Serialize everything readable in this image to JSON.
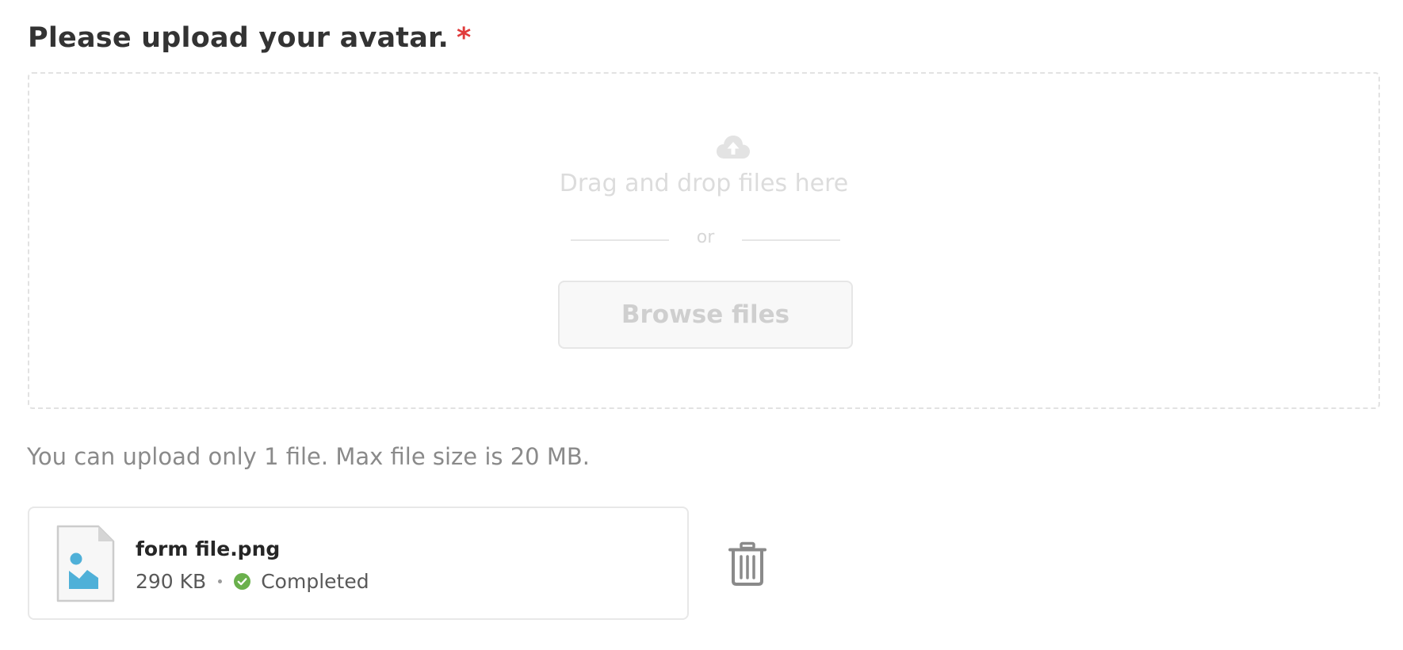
{
  "upload": {
    "label": "Please upload your avatar.",
    "required_marker": "*",
    "dropzone": {
      "icon": "cloud-upload-icon",
      "drag_text": "Drag and drop files here",
      "separator_text": "or",
      "browse_label": "Browse files"
    },
    "helper_text": "You can upload only 1 file. Max file size is 20 MB."
  },
  "files": [
    {
      "name": "form file.png",
      "size": "290 KB",
      "status": "Completed",
      "file_icon": "image-file-icon",
      "status_icon": "check-circle-icon",
      "delete_icon": "trash-icon"
    }
  ],
  "colors": {
    "required": "#e03b3b",
    "success": "#6ab04c",
    "image_accent": "#4fb0d8",
    "muted_text": "#8a8a8a"
  }
}
